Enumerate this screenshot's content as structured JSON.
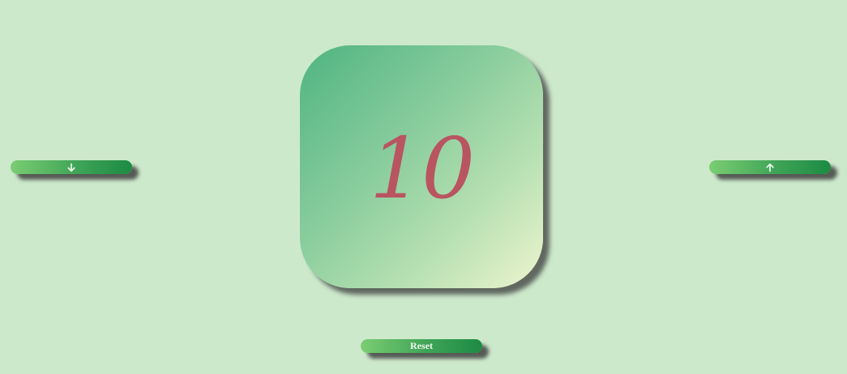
{
  "counter": {
    "value": "10"
  },
  "controls": {
    "decrement_icon": "arrow-down-icon",
    "increment_icon": "arrow-up-icon",
    "reset_label": "Reset"
  },
  "colors": {
    "background": "#cde9cc",
    "card_gradient_start": "#4fb482",
    "card_gradient_end": "#eef4cf",
    "value_text": "#b85560",
    "button_start": "#7acd72",
    "button_end": "#1c8b43"
  }
}
